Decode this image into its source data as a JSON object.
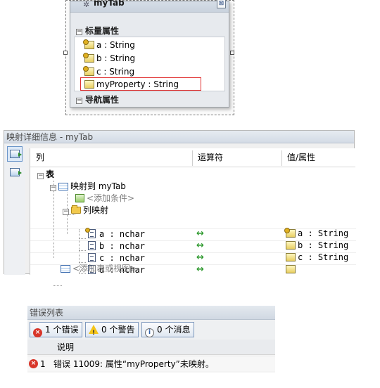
{
  "entity": {
    "title": "myTab",
    "collapse_glyph": "⊠",
    "scalar_section": "标量属性",
    "navigation_section": "导航属性",
    "properties": [
      {
        "label": "a : String",
        "key": true
      },
      {
        "label": "b : String",
        "key": true
      },
      {
        "label": "c : String",
        "key": true
      },
      {
        "label": "myProperty : String",
        "key": false,
        "selected": true
      }
    ]
  },
  "mapping": {
    "title": "映射详细信息 - myTab",
    "columns": {
      "col": "列",
      "operator": "运算符",
      "value": "值/属性"
    },
    "tables_node": "表",
    "mapped_to": "映射到 myTab",
    "add_condition": "<添加条件>",
    "column_mappings": "列映射",
    "rows": [
      {
        "column": "a : nchar",
        "operator": "↔",
        "value": "a : String",
        "key": true
      },
      {
        "column": "b : nchar",
        "operator": "↔",
        "value": "b : String",
        "key": false
      },
      {
        "column": "c : nchar",
        "operator": "↔",
        "value": "c : String",
        "key": false
      },
      {
        "column": "d : nchar",
        "operator": "↔",
        "value": "",
        "key": false
      }
    ],
    "add_table": "<添加表或视图>"
  },
  "errors": {
    "title": "错误列表",
    "filters": {
      "errors": "1 个错误",
      "warnings": "0 个警告",
      "messages": "0 个消息"
    },
    "header": "说明",
    "items": [
      {
        "index": "1",
        "description": "错误 11009: 属性“myProperty”未映射。"
      }
    ]
  },
  "colors": {
    "error_red": "#d8362a",
    "selection_red": "#e03030",
    "mapping_arrow": "#2f9a2f"
  }
}
